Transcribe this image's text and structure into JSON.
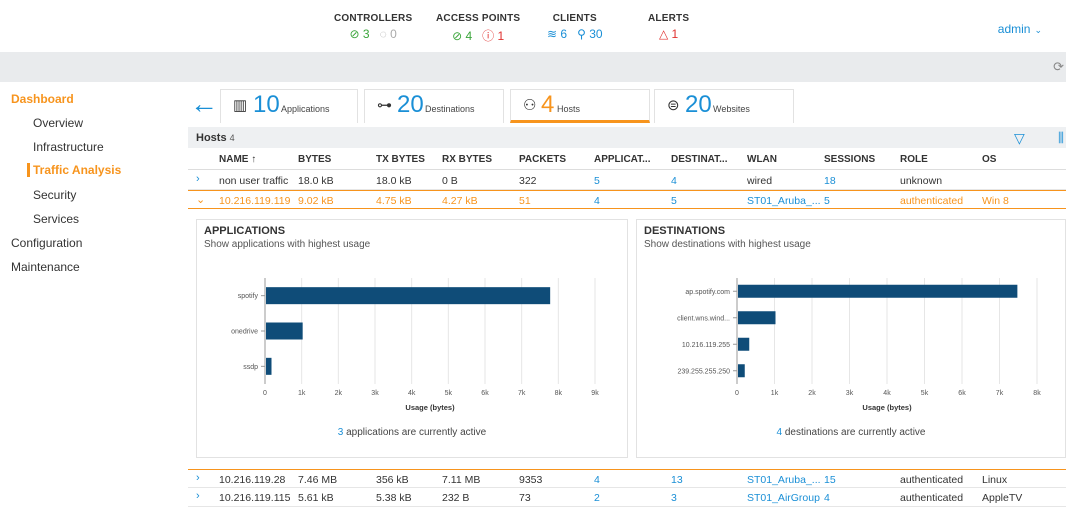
{
  "topbar": {
    "controllers": {
      "title": "CONTROLLERS",
      "up": "3",
      "down": "0"
    },
    "access_points": {
      "title": "ACCESS POINTS",
      "up": "4",
      "down": "1"
    },
    "clients": {
      "title": "CLIENTS",
      "wifi": "6",
      "wired": "30"
    },
    "alerts": {
      "title": "ALERTS",
      "count": "1"
    },
    "user": "admin"
  },
  "sidebar": {
    "dashboard": "Dashboard",
    "overview": "Overview",
    "infrastructure": "Infrastructure",
    "traffic_analysis": "Traffic Analysis",
    "security": "Security",
    "services": "Services",
    "configuration": "Configuration",
    "maintenance": "Maintenance"
  },
  "tabs": [
    {
      "count": "10",
      "label": "Applications"
    },
    {
      "count": "20",
      "label": "Destinations"
    },
    {
      "count": "4",
      "label": "Hosts"
    },
    {
      "count": "20",
      "label": "Websites"
    }
  ],
  "hosts": {
    "title": "Hosts",
    "count": "4"
  },
  "columns": [
    "NAME",
    "BYTES",
    "TX BYTES",
    "RX BYTES",
    "PACKETS",
    "APPLICAT...",
    "DESTINAT...",
    "WLAN",
    "SESSIONS",
    "ROLE",
    "OS"
  ],
  "rows": [
    {
      "name": "non user traffic",
      "bytes": "18.0 kB",
      "tx": "18.0 kB",
      "rx": "0 B",
      "packets": "322",
      "apps": "5",
      "dest": "4",
      "wlan": "wired",
      "sessions": "18",
      "role": "unknown",
      "os": ""
    },
    {
      "name": "10.216.119.119",
      "bytes": "9.02 kB",
      "tx": "4.75 kB",
      "rx": "4.27 kB",
      "packets": "51",
      "apps": "4",
      "dest": "5",
      "wlan": "ST01_Aruba_...",
      "sessions": "5",
      "role": "authenticated",
      "os": "Win 8"
    },
    {
      "name": "10.216.119.28",
      "bytes": "7.46 MB",
      "tx": "356 kB",
      "rx": "7.11 MB",
      "packets": "9353",
      "apps": "4",
      "dest": "13",
      "wlan": "ST01_Aruba_...",
      "sessions": "15",
      "role": "authenticated",
      "os": "Linux"
    },
    {
      "name": "10.216.119.115",
      "bytes": "5.61 kB",
      "tx": "5.38 kB",
      "rx": "232 B",
      "packets": "73",
      "apps": "2",
      "dest": "3",
      "wlan": "ST01_AirGroup",
      "sessions": "4",
      "role": "authenticated",
      "os": "AppleTV"
    }
  ],
  "applications_panel": {
    "title": "APPLICATIONS",
    "subtitle": "Show applications with highest usage",
    "active_count": "3",
    "active_text": "applications are currently active"
  },
  "destinations_panel": {
    "title": "DESTINATIONS",
    "subtitle": "Show destinations with highest usage",
    "active_count": "4",
    "active_text": "destinations are currently active"
  },
  "chart_data": [
    {
      "type": "bar",
      "orientation": "horizontal",
      "categories": [
        "spotify",
        "onedrive",
        "ssdp"
      ],
      "values": [
        7750,
        1000,
        150
      ],
      "xlabel": "Usage (bytes)",
      "xlim": [
        0,
        9000
      ],
      "xticks": [
        "0",
        "1k",
        "2k",
        "3k",
        "4k",
        "5k",
        "6k",
        "7k",
        "8k",
        "9k"
      ],
      "bar_color": "#0f4c78"
    },
    {
      "type": "bar",
      "orientation": "horizontal",
      "categories": [
        "ap.spotify.com",
        "client.wns.wind...",
        "10.216.119.255",
        "239.255.255.250"
      ],
      "values": [
        7450,
        1000,
        300,
        180
      ],
      "xlabel": "Usage (bytes)",
      "xlim": [
        0,
        8000
      ],
      "xticks": [
        "0",
        "1k",
        "2k",
        "3k",
        "4k",
        "5k",
        "6k",
        "7k",
        "8k"
      ],
      "bar_color": "#0f4c78"
    }
  ]
}
